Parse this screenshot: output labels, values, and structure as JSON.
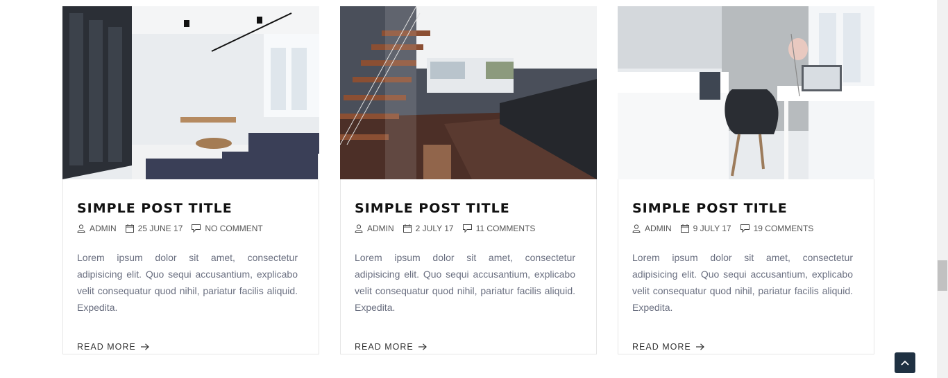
{
  "posts": [
    {
      "title": "SIMPLE POST TITLE",
      "author": "ADMIN",
      "date": "25 JUNE 17",
      "comments": "NO COMMENT",
      "excerpt": "Lorem ipsum dolor sit amet, consectetur adipisicing elit. Quo sequi accusantium, explicabo velit consequatur quod nihil, pariatur facilis aliquid. Expedita.",
      "read_more": "READ MORE"
    },
    {
      "title": "SIMPLE POST TITLE",
      "author": "ADMIN",
      "date": "2 JULY 17",
      "comments": "11 COMMENTS",
      "excerpt": "Lorem ipsum dolor sit amet, consectetur adipisicing elit. Quo sequi accusantium, explicabo velit consequatur quod nihil, pariatur facilis aliquid. Expedita.",
      "read_more": "READ MORE"
    },
    {
      "title": "SIMPLE POST TITLE",
      "author": "ADMIN",
      "date": "9 JULY 17",
      "comments": "19 COMMENTS",
      "excerpt": "Lorem ipsum dolor sit amet, consectetur adipisicing elit. Quo sequi accusantium, explicabo velit consequatur quod nihil, pariatur facilis aliquid. Expedita.",
      "read_more": "READ MORE"
    }
  ],
  "icons": {
    "author": "user-icon",
    "date": "calendar-icon",
    "comments": "comment-icon",
    "read_more": "arrow-right-icon",
    "back_to_top": "chevron-up-icon"
  },
  "colors": {
    "title": "#111111",
    "excerpt": "#6a6f80",
    "back_to_top_bg": "#1f3142"
  }
}
